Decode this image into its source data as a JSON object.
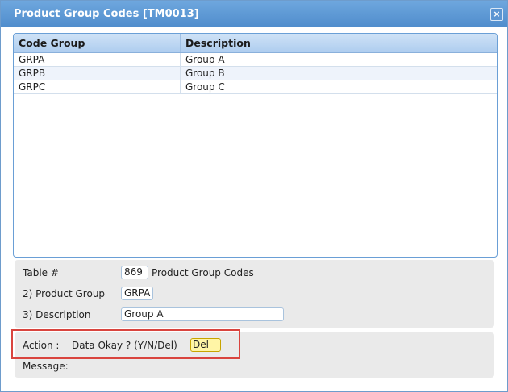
{
  "dialog": {
    "title": "Product Group Codes [TM0013]",
    "close_label": "×"
  },
  "grid": {
    "columns": [
      "Code Group",
      "Description"
    ],
    "rows": [
      {
        "code": "GRPA",
        "description": "Group A"
      },
      {
        "code": "GRPB",
        "description": "Group B"
      },
      {
        "code": "GRPC",
        "description": "Group C"
      }
    ]
  },
  "form": {
    "table_label": "Table #",
    "table_number": "869",
    "table_name": "Product Group Codes",
    "product_group_label": "2) Product Group",
    "product_group_value": "GRPA",
    "description_label": "3) Description",
    "description_value": "Group A"
  },
  "action": {
    "label": "Action :",
    "prompt": "Data Okay ? (Y/N/Del)",
    "value": "Del",
    "message_label": "Message:"
  }
}
